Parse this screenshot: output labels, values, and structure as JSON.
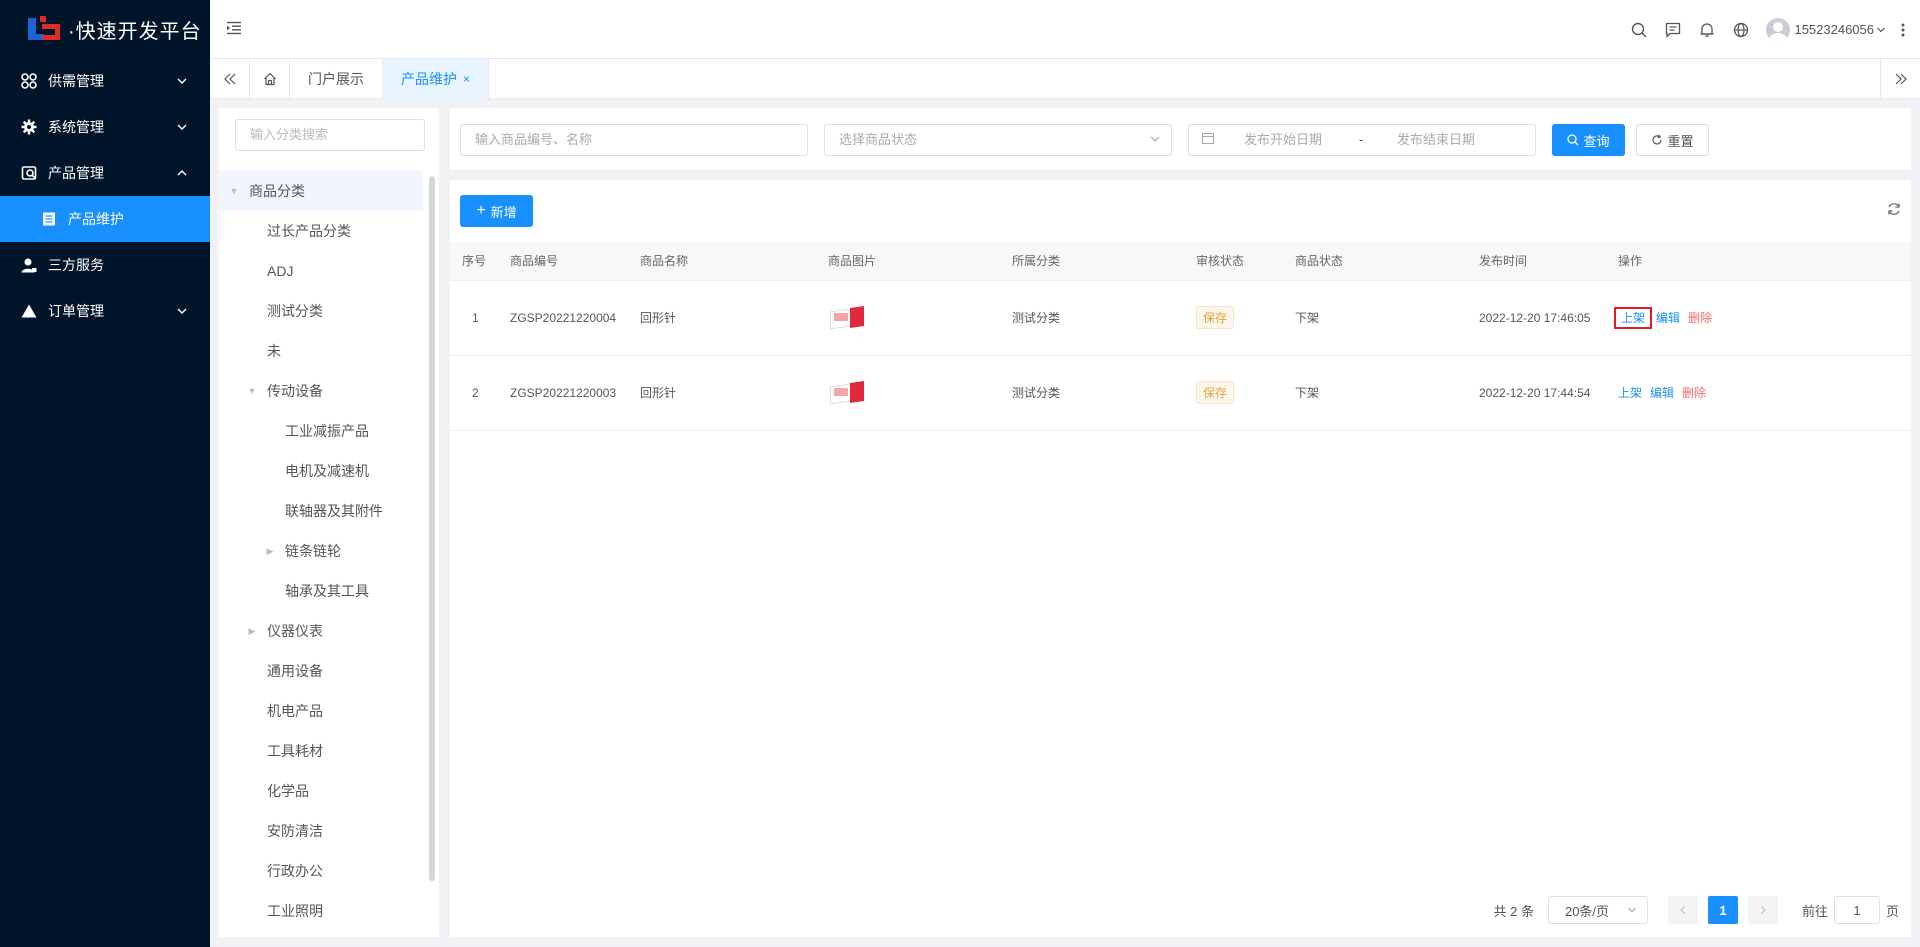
{
  "app": {
    "title": "·快速开发平台"
  },
  "sidebar": {
    "items": [
      {
        "label": "供需管理",
        "icon": "grid-icon",
        "expanded": false
      },
      {
        "label": "系统管理",
        "icon": "gear-icon",
        "expanded": false
      },
      {
        "label": "产品管理",
        "icon": "product-icon",
        "expanded": true,
        "children": [
          {
            "label": "产品维护",
            "icon": "document-icon",
            "active": true
          }
        ]
      },
      {
        "label": "三方服务",
        "icon": "user-icon"
      },
      {
        "label": "订单管理",
        "icon": "triangle-icon",
        "expanded": false
      }
    ]
  },
  "header": {
    "username": "15523246056"
  },
  "tabs": [
    {
      "label": "门户展示",
      "active": false
    },
    {
      "label": "产品维护",
      "active": true,
      "close": "×"
    }
  ],
  "tree": {
    "search_placeholder": "输入分类搜索",
    "nodes": [
      {
        "label": "商品分类",
        "level": 0,
        "caret": "▼",
        "selected": true
      },
      {
        "label": "过长产品分类",
        "level": 1
      },
      {
        "label": "ADJ",
        "level": 1
      },
      {
        "label": "测试分类",
        "level": 1
      },
      {
        "label": "未",
        "level": 1
      },
      {
        "label": "传动设备",
        "level": 1,
        "caret": "▼"
      },
      {
        "label": "工业减振产品",
        "level": 2
      },
      {
        "label": "电机及减速机",
        "level": 2
      },
      {
        "label": "联轴器及其附件",
        "level": 2
      },
      {
        "label": "链条链轮",
        "level": 2,
        "caret": "▶"
      },
      {
        "label": "轴承及其工具",
        "level": 2
      },
      {
        "label": "仪器仪表",
        "level": 1,
        "caret": "▶"
      },
      {
        "label": "通用设备",
        "level": 1
      },
      {
        "label": "机电产品",
        "level": 1
      },
      {
        "label": "工具耗材",
        "level": 1
      },
      {
        "label": "化学品",
        "level": 1
      },
      {
        "label": "安防清洁",
        "level": 1
      },
      {
        "label": "行政办公",
        "level": 1
      },
      {
        "label": "工业照明",
        "level": 1
      }
    ]
  },
  "filter": {
    "keyword_placeholder": "输入商品编号、名称",
    "status_placeholder": "选择商品状态",
    "start_date_placeholder": "发布开始日期",
    "date_separator": "-",
    "end_date_placeholder": "发布结束日期",
    "search_label": "查询",
    "reset_label": "重置"
  },
  "toolbar": {
    "add_label": "新增"
  },
  "table": {
    "columns": [
      "序号",
      "商品编号",
      "商品名称",
      "商品图片",
      "所属分类",
      "审核状态",
      "商品状态",
      "发布时间",
      "操作"
    ],
    "rows": [
      {
        "index": "1",
        "code": "ZGSP20221220004",
        "name": "回形针",
        "category": "测试分类",
        "audit": "保存",
        "status": "下架",
        "time": "2022-12-20 17:46:05"
      },
      {
        "index": "2",
        "code": "ZGSP20221220003",
        "name": "回形针",
        "category": "测试分类",
        "audit": "保存",
        "status": "下架",
        "time": "2022-12-20 17:44:54"
      }
    ],
    "actions": {
      "publish": "上架",
      "edit": "编辑",
      "delete": "删除"
    }
  },
  "pagination": {
    "total": "共 2 条",
    "page_size": "20条/页",
    "current": "1",
    "goto_label": "前往",
    "goto_value": "1",
    "page_suffix": "页"
  },
  "colors": {
    "primary": "#1890ff",
    "sidebar_bg": "#001529",
    "danger": "#f56c6c",
    "warning": "#e6a23c",
    "highlight_box": "#e02020"
  }
}
